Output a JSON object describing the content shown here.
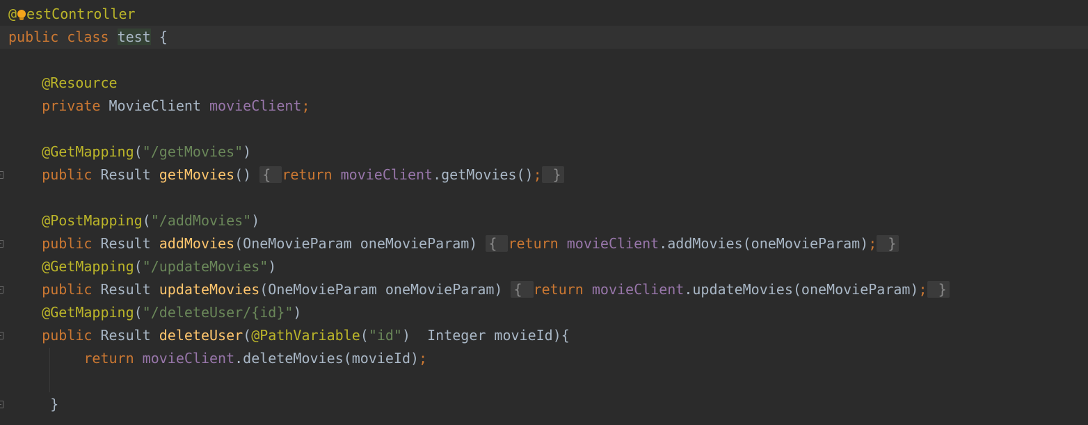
{
  "editor": {
    "lines": [
      {
        "tokens": [
          {
            "t": "@",
            "c": "ann"
          },
          {
            "t": "BULB",
            "c": "bulb"
          },
          {
            "t": "estController",
            "c": "ann"
          }
        ]
      },
      {
        "tokens": [
          {
            "t": "public",
            "c": "kw"
          },
          {
            "t": " "
          },
          {
            "t": "class",
            "c": "kw"
          },
          {
            "t": " "
          },
          {
            "t": "test",
            "c": "plain hl"
          },
          {
            "t": " {"
          }
        ]
      },
      {
        "tokens": []
      },
      {
        "tokens": [
          {
            "t": "    "
          },
          {
            "t": "@Resource",
            "c": "ann"
          }
        ]
      },
      {
        "tokens": [
          {
            "t": "    "
          },
          {
            "t": "private",
            "c": "kw"
          },
          {
            "t": " MovieClient "
          },
          {
            "t": "movieClient",
            "c": "fld"
          },
          {
            "t": ";",
            "c": "kw"
          }
        ]
      },
      {
        "tokens": []
      },
      {
        "tokens": [
          {
            "t": "    "
          },
          {
            "t": "@GetMapping",
            "c": "ann"
          },
          {
            "t": "("
          },
          {
            "t": "\"/getMovies\"",
            "c": "str"
          },
          {
            "t": ")"
          }
        ]
      },
      {
        "tokens": [
          {
            "t": "    "
          },
          {
            "t": "public",
            "c": "kw"
          },
          {
            "t": " Result "
          },
          {
            "t": "getMovies",
            "c": "fn"
          },
          {
            "t": "() "
          },
          {
            "t": "{ ",
            "c": "fold"
          },
          {
            "t": "return",
            "c": "kw"
          },
          {
            "t": " "
          },
          {
            "t": "movieClient",
            "c": "fld"
          },
          {
            "t": ".getMovies()"
          },
          {
            "t": ";",
            "c": "kw"
          },
          {
            "t": " }",
            "c": "fold"
          }
        ]
      },
      {
        "tokens": []
      },
      {
        "tokens": [
          {
            "t": "    "
          },
          {
            "t": "@PostMapping",
            "c": "ann"
          },
          {
            "t": "("
          },
          {
            "t": "\"/addMovies\"",
            "c": "str"
          },
          {
            "t": ")"
          }
        ]
      },
      {
        "tokens": [
          {
            "t": "    "
          },
          {
            "t": "public",
            "c": "kw"
          },
          {
            "t": " Result "
          },
          {
            "t": "addMovies",
            "c": "fn"
          },
          {
            "t": "(OneMovieParam oneMovieParam) "
          },
          {
            "t": "{ ",
            "c": "fold"
          },
          {
            "t": "return",
            "c": "kw"
          },
          {
            "t": " "
          },
          {
            "t": "movieClient",
            "c": "fld"
          },
          {
            "t": ".addMovies(oneMovieParam)"
          },
          {
            "t": ";",
            "c": "kw"
          },
          {
            "t": " }",
            "c": "fold"
          }
        ]
      },
      {
        "tokens": [
          {
            "t": "    "
          },
          {
            "t": "@GetMapping",
            "c": "ann"
          },
          {
            "t": "("
          },
          {
            "t": "\"/updateMovies\"",
            "c": "str"
          },
          {
            "t": ")"
          }
        ]
      },
      {
        "tokens": [
          {
            "t": "    "
          },
          {
            "t": "public",
            "c": "kw"
          },
          {
            "t": " Result "
          },
          {
            "t": "updateMovies",
            "c": "fn"
          },
          {
            "t": "(OneMovieParam oneMovieParam) "
          },
          {
            "t": "{ ",
            "c": "fold"
          },
          {
            "t": "return",
            "c": "kw"
          },
          {
            "t": " "
          },
          {
            "t": "movieClient",
            "c": "fld"
          },
          {
            "t": ".updateMovies(oneMovieParam)"
          },
          {
            "t": ";",
            "c": "kw"
          },
          {
            "t": " }",
            "c": "fold"
          }
        ]
      },
      {
        "tokens": [
          {
            "t": "    "
          },
          {
            "t": "@GetMapping",
            "c": "ann"
          },
          {
            "t": "("
          },
          {
            "t": "\"/deleteUser/{id}\"",
            "c": "str"
          },
          {
            "t": ")"
          }
        ]
      },
      {
        "tokens": [
          {
            "t": "    "
          },
          {
            "t": "public",
            "c": "kw"
          },
          {
            "t": " Result "
          },
          {
            "t": "deleteUser",
            "c": "fn"
          },
          {
            "t": "("
          },
          {
            "t": "@PathVariable",
            "c": "ann"
          },
          {
            "t": "("
          },
          {
            "t": "\"id\"",
            "c": "str"
          },
          {
            "t": ")  Integer movieId){"
          }
        ]
      },
      {
        "tokens": [
          {
            "t": "         "
          },
          {
            "t": "return",
            "c": "kw"
          },
          {
            "t": " "
          },
          {
            "t": "movieClient",
            "c": "fld"
          },
          {
            "t": ".deleteMovies(movieId)"
          },
          {
            "t": ";",
            "c": "kw"
          }
        ]
      },
      {
        "tokens": []
      },
      {
        "tokens": [
          {
            "t": "     }"
          }
        ]
      }
    ],
    "fold_marker_lines": [
      7,
      10,
      12,
      14,
      17
    ]
  }
}
